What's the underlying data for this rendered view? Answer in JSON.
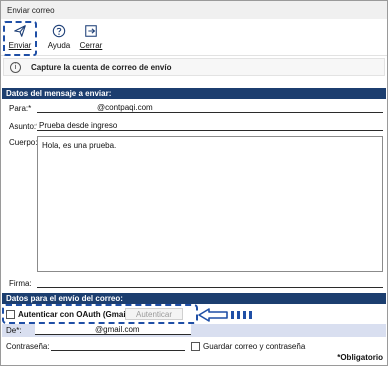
{
  "window": {
    "title": "Enviar correo"
  },
  "toolbar": {
    "send_label": "Enviar",
    "help_label": "Ayuda",
    "close_label": "Cerrar"
  },
  "info": {
    "message": "Capture la cuenta de correo de envío"
  },
  "sections": {
    "message_header": "Datos del mensaje a enviar:",
    "sender_header": "Datos para el envío del correo:"
  },
  "message": {
    "to_label": "Para:*",
    "to_value": "@contpaqi.com",
    "subject_label": "Asunto:*",
    "subject_value": "Prueba desde ingreso",
    "body_label": "Cuerpo:",
    "body_value": "Hola, es una prueba.",
    "signature_label": "Firma:",
    "signature_value": ""
  },
  "sender": {
    "oauth_label": "Autenticar con OAuth (Gmail):",
    "oauth_checked": false,
    "auth_button": "Autenticar",
    "from_label": "De*:",
    "from_value": "@gmail.com",
    "password_label": "Contraseña:",
    "password_value": "",
    "save_label": "Guardar correo y contraseña",
    "save_checked": false
  },
  "footer": {
    "required_note": "*Obligatorio"
  },
  "colors": {
    "header_bg": "#1c3e6f",
    "highlight": "#1f4fa6",
    "from_band": "#d9dff0"
  }
}
